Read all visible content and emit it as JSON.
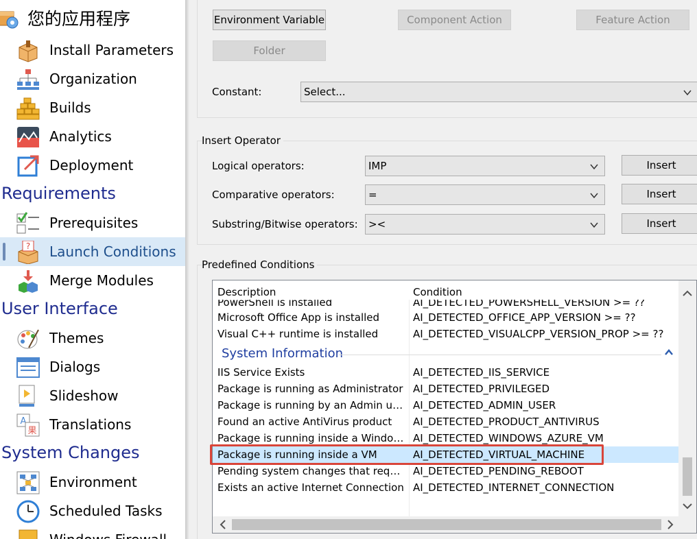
{
  "sidebar": {
    "app_title": "您的应用程序",
    "items_top": [
      {
        "label": "Install Parameters",
        "icon": "install-parameters-icon"
      },
      {
        "label": "Organization",
        "icon": "organization-icon"
      },
      {
        "label": "Builds",
        "icon": "builds-icon"
      },
      {
        "label": "Analytics",
        "icon": "analytics-icon"
      },
      {
        "label": "Deployment",
        "icon": "deployment-icon"
      }
    ],
    "sections": [
      {
        "title": "Requirements",
        "items": [
          {
            "label": "Prerequisites",
            "icon": "prerequisites-icon"
          },
          {
            "label": "Launch Conditions",
            "icon": "launch-conditions-icon",
            "selected": true
          },
          {
            "label": "Merge Modules",
            "icon": "merge-modules-icon"
          }
        ]
      },
      {
        "title": "User Interface",
        "items": [
          {
            "label": "Themes",
            "icon": "themes-icon"
          },
          {
            "label": "Dialogs",
            "icon": "dialogs-icon"
          },
          {
            "label": "Slideshow",
            "icon": "slideshow-icon"
          },
          {
            "label": "Translations",
            "icon": "translations-icon"
          }
        ]
      },
      {
        "title": "System Changes",
        "items": [
          {
            "label": "Environment",
            "icon": "environment-icon"
          },
          {
            "label": "Scheduled Tasks",
            "icon": "scheduled-tasks-icon"
          },
          {
            "label": "Windows Firewall",
            "icon": "windows-firewall-icon"
          }
        ]
      }
    ]
  },
  "insert_value": {
    "environment_variable": "Environment Variable",
    "component_action": "Component Action",
    "feature_action": "Feature Action",
    "folder": "Folder",
    "constant_label": "Constant:",
    "constant_value": "Select..."
  },
  "insert_operator": {
    "title": "Insert Operator",
    "logical_label": "Logical operators:",
    "logical_value": "IMP",
    "comparative_label": "Comparative operators:",
    "comparative_value": "=",
    "substring_label": "Substring/Bitwise operators:",
    "substring_value": "><",
    "insert_label": "Insert"
  },
  "predefined": {
    "title": "Predefined Conditions",
    "col_description": "Description",
    "col_condition": "Condition",
    "rows_before": [
      {
        "desc": "PowerShell is installed",
        "cond": "AI_DETECTED_POWERSHELL_VERSION >= ??"
      },
      {
        "desc": "Microsoft Office App is installed",
        "cond": "AI_DETECTED_OFFICE_APP_VERSION >= ??"
      },
      {
        "desc": "Visual C++ runtime is installed",
        "cond": "AI_DETECTED_VISUALCPP_VERSION_PROP >= ??"
      }
    ],
    "group_label": "System Information",
    "rows_after": [
      {
        "desc": "IIS Service Exists",
        "cond": "AI_DETECTED_IIS_SERVICE"
      },
      {
        "desc": "Package is running as Administrator",
        "cond": "AI_DETECTED_PRIVILEGED"
      },
      {
        "desc": "Package is running by an Admin user",
        "cond": "AI_DETECTED_ADMIN_USER"
      },
      {
        "desc": "Found an active AntiVirus product",
        "cond": "AI_DETECTED_PRODUCT_ANTIVIRUS"
      },
      {
        "desc": "Package is running inside a Window...",
        "cond": "AI_DETECTED_WINDOWS_AZURE_VM"
      },
      {
        "desc": "Package is running inside a VM",
        "cond": "AI_DETECTED_VIRTUAL_MACHINE",
        "selected": true
      },
      {
        "desc": "Pending system changes that require...",
        "cond": "AI_DETECTED_PENDING_REBOOT"
      },
      {
        "desc": "Exists an active Internet Connection",
        "cond": "AI_DETECTED_INTERNET_CONNECTION"
      }
    ]
  },
  "colors": {
    "selection": "#cce8ff",
    "highlight_border": "#d9453a",
    "section_header": "#1f2c8f"
  }
}
